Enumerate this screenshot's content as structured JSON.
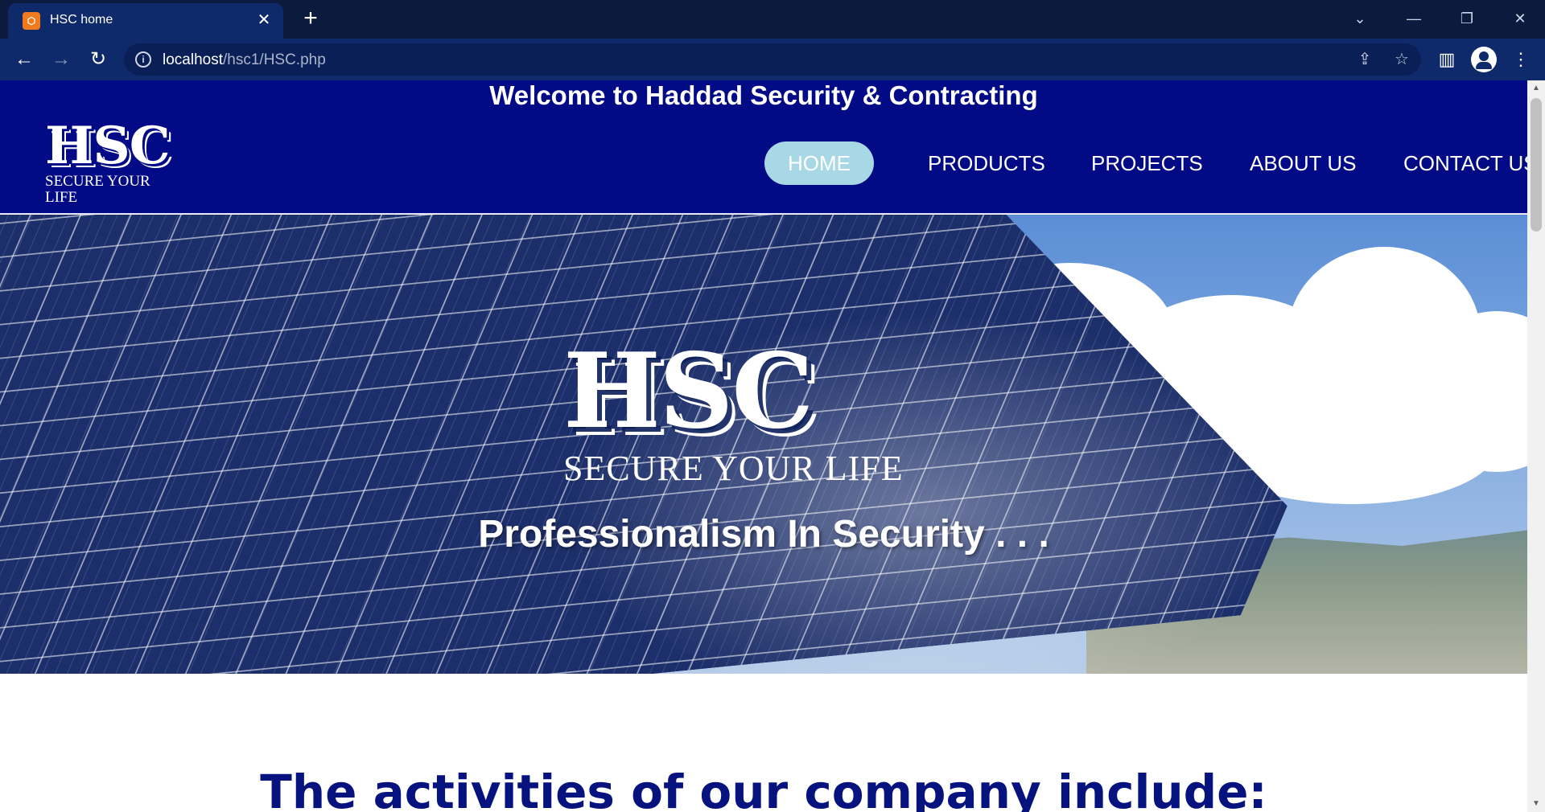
{
  "browser": {
    "tab_title": "HSC home",
    "tab_favicon": "xampp-icon",
    "url_host": "localhost",
    "url_path": "/hsc1/HSC.php"
  },
  "site": {
    "welcome": "Welcome to Haddad Security & Contracting",
    "logo": {
      "letters": "HSC",
      "tagline": "SECURE YOUR LIFE"
    },
    "nav": [
      {
        "label": "HOME",
        "active": true
      },
      {
        "label": "PRODUCTS",
        "active": false
      },
      {
        "label": "PROJECTS",
        "active": false
      },
      {
        "label": "ABOUT US",
        "active": false
      },
      {
        "label": "CONTACT US",
        "active": false
      }
    ],
    "hero": {
      "letters": "HSC",
      "tagline": "SECURE YOUR LIFE",
      "subtitle": "Professionalism In Security . . ."
    },
    "activities_heading": "The activities of our company include:"
  },
  "colors": {
    "header_bg": "#020a85",
    "active_nav_bg": "#a8d8e6",
    "heading": "#06137f",
    "chrome_tabbar": "#0c1a3d",
    "chrome_toolbar": "#0f2a6b"
  }
}
